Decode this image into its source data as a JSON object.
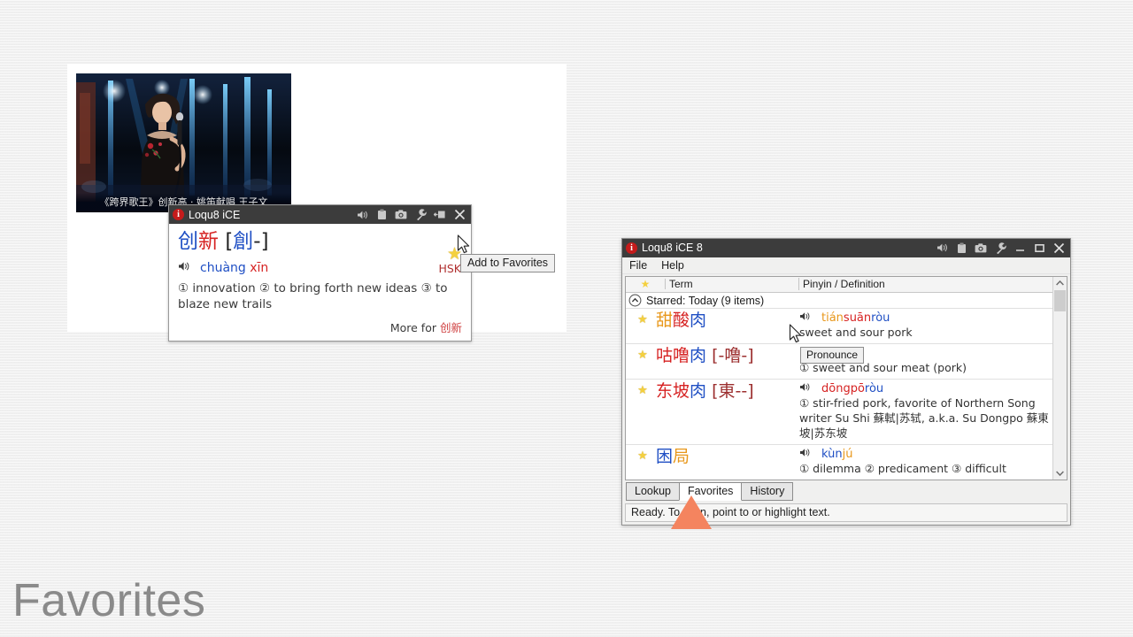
{
  "slide": {
    "caption": "Favorites"
  },
  "video": {
    "caption": "《跨界歌王》创新高 · 姚笛献唱 王子文"
  },
  "popup": {
    "title": "Loqu8 iCE",
    "badge": "i",
    "titlebar_icons": [
      "speaker-icon",
      "clipboard-icon",
      "camera-icon",
      "wrench-icon",
      "pin-icon",
      "close-icon"
    ],
    "headword": {
      "char1": "创",
      "char2": "新",
      "variant_open": "[",
      "variant": "創",
      "variant_dash": "-",
      "variant_close": "]"
    },
    "star": "★",
    "pinyin": {
      "syl1": "chuàng",
      "syl2": "xīn"
    },
    "hsk": "HSK",
    "definition": "① innovation ② to bring forth new ideas ③ to blaze new trails",
    "more_label": "More for",
    "more_term": "创新"
  },
  "tooltips": {
    "add_to_favorites": "Add to Favorites",
    "pronounce": "Pronounce"
  },
  "mainwin": {
    "title": "Loqu8 iCE 8",
    "badge": "i",
    "titlebar_icons": [
      "speaker-icon",
      "clipboard-icon",
      "camera-icon",
      "wrench-icon",
      "minimize-icon",
      "maximize-icon",
      "close-icon"
    ],
    "menu": [
      "File",
      "Help"
    ],
    "columns": {
      "star": "★",
      "term": "Term",
      "definition": "Pinyin / Definition"
    },
    "group": {
      "label": "Starred: Today (9 items)"
    },
    "entries": [
      {
        "star": "★",
        "term_chars": [
          {
            "text": "甜",
            "tone": "t2"
          },
          {
            "text": "酸",
            "tone": "t1"
          },
          {
            "text": "肉",
            "tone": "t4"
          }
        ],
        "variant": "",
        "pinyin": [
          {
            "text": "tián",
            "tone": "t2"
          },
          {
            "text": "suān",
            "tone": "t1"
          },
          {
            "text": "ròu",
            "tone": "t4"
          }
        ],
        "definition": "sweet and sour pork"
      },
      {
        "star": "★",
        "term_chars": [
          {
            "text": "咕",
            "tone": "t1"
          },
          {
            "text": "噜",
            "tone": "t1"
          },
          {
            "text": "肉",
            "tone": "t4"
          }
        ],
        "variant": "[-噜-]",
        "pinyin": [],
        "definition": "① sweet and sour meat (pork)"
      },
      {
        "star": "★",
        "term_chars": [
          {
            "text": "东",
            "tone": "t1"
          },
          {
            "text": "坡",
            "tone": "t1"
          },
          {
            "text": "肉",
            "tone": "t4"
          }
        ],
        "variant": "[東--]",
        "pinyin": [
          {
            "text": "dōng",
            "tone": "t1"
          },
          {
            "text": "pō",
            "tone": "t1"
          },
          {
            "text": "ròu",
            "tone": "t4"
          }
        ],
        "definition": "① stir-fried pork, favorite of Northern Song writer Su Shi 蘇軾|苏轼, a.k.a. Su Dongpo 蘇東坡|苏东坡"
      },
      {
        "star": "★",
        "term_chars": [
          {
            "text": "困",
            "tone": "t4"
          },
          {
            "text": "局",
            "tone": "t2"
          }
        ],
        "variant": "",
        "pinyin": [
          {
            "text": "kùn",
            "tone": "t4"
          },
          {
            "text": "jú",
            "tone": "t2"
          }
        ],
        "definition": "① dilemma ② predicament ③ difficult"
      }
    ],
    "tabs": [
      {
        "label": "Lookup",
        "active": false
      },
      {
        "label": "Favorites",
        "active": true
      },
      {
        "label": "History",
        "active": false
      }
    ],
    "status": "Ready. To scan, point to or highlight text."
  },
  "colors": {
    "tone1_red": "#d62222",
    "tone2_orange": "#e8971a",
    "tone4_blue": "#1f4fc4",
    "variant_dark_red": "#9c2f2f",
    "titlebar": "#3c3c3c",
    "badge_red": "#c41b1b",
    "star_yellow": "#f4d03f",
    "annotation_orange": "#f4845f"
  }
}
